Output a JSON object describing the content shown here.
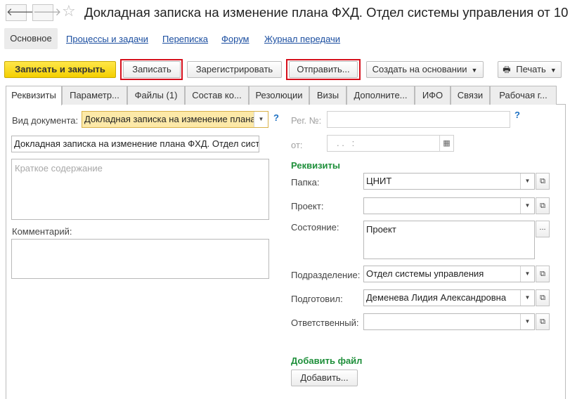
{
  "window": {
    "title": "Докладная записка на изменение плана ФХД. Отдел системы управления от 10"
  },
  "nav": {
    "back_icon": "arrow-left-icon",
    "forward_icon": "arrow-right-icon",
    "favorite_icon": "star-icon",
    "links": [
      "Основное",
      "Процессы и задачи",
      "Переписка",
      "Форум",
      "Журнал передачи"
    ]
  },
  "toolbar": {
    "save_close": "Записать и закрыть",
    "save": "Записать",
    "register": "Зарегистрировать",
    "send": "Отправить...",
    "create_based": "Создать на основании",
    "print": "Печать",
    "highlight_color": "#d6101c"
  },
  "tabs": [
    "Реквизиты",
    "Параметр...",
    "Файлы (1)",
    "Состав ко...",
    "Резолюции",
    "Визы",
    "Дополните...",
    "ИФО",
    "Связи",
    "Рабочая г..."
  ],
  "form": {
    "doc_type_label": "Вид документа:",
    "doc_type_value": "Докладная записка на изменение плана",
    "doc_name_value": "Докладная записка на изменение плана ФХД. Отдел сист",
    "summary_placeholder": "Краткое содержание",
    "comment_label": "Комментарий:",
    "reg_no_label": "Рег. №:",
    "date_label": "от:",
    "date_mask": ". .   :",
    "help": "?",
    "requisites_header": "Реквизиты",
    "folder_label": "Папка:",
    "folder_value": "ЦНИТ",
    "project_label": "Проект:",
    "project_value": "",
    "state_label": "Состояние:",
    "state_value": "Проект",
    "department_label": "Подразделение:",
    "department_value": "Отдел системы управления",
    "prepared_label": "Подготовил:",
    "prepared_value": "Деменева Лидия Александровна",
    "responsible_label": "Ответственный:",
    "responsible_value": "",
    "add_file_header": "Добавить файл",
    "add_button": "Добавить..."
  }
}
